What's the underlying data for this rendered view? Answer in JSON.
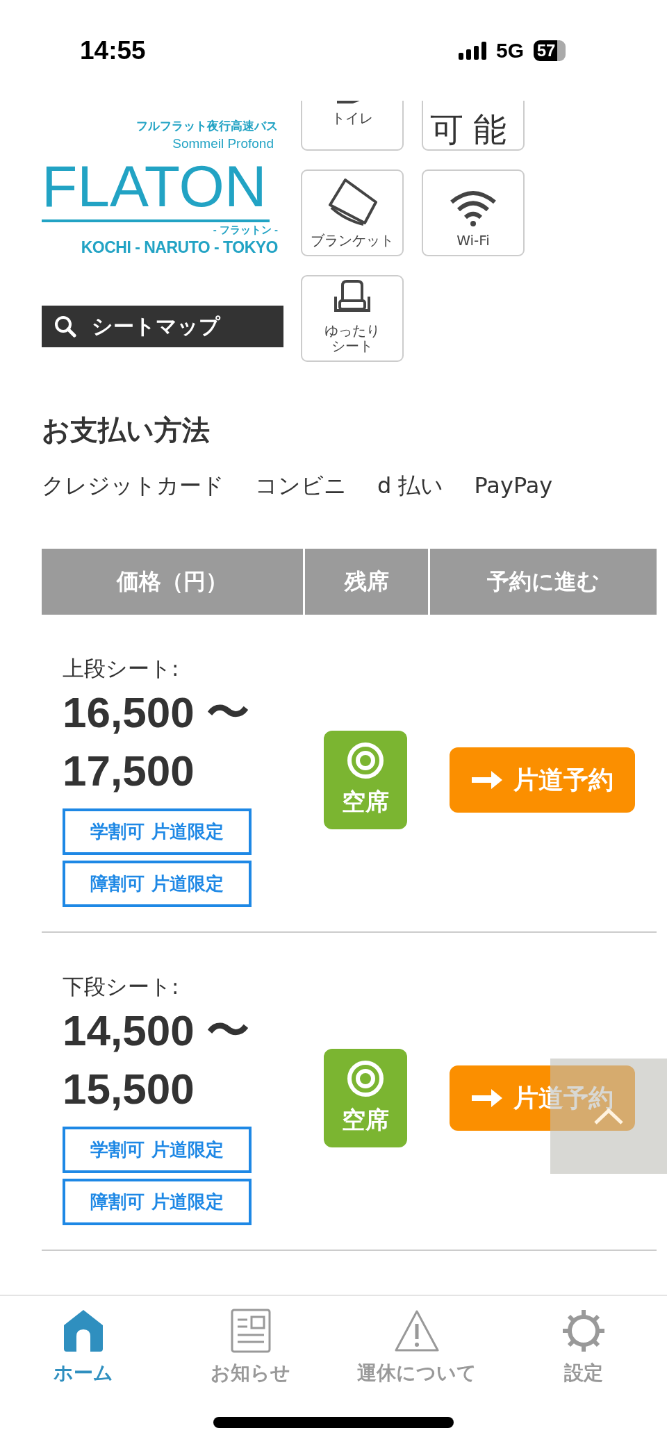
{
  "status_bar": {
    "time": "14:55",
    "network": "5G",
    "battery": "57"
  },
  "logo": {
    "tagline": "フルフラット夜行高速バス",
    "subtitle": "Sommeil Profond",
    "name": "FLATON",
    "reading": "- フラットン -",
    "route": "KOCHI - NARUTO - TOKYO"
  },
  "seat_map_button": "シートマップ",
  "amenities": [
    {
      "kind": "toilet",
      "label": "トイレ"
    },
    {
      "kind": "text",
      "label": "可能"
    },
    {
      "kind": "blanket",
      "label": "ブランケット"
    },
    {
      "kind": "wifi",
      "label": "Wi-Fi"
    },
    {
      "kind": "seat",
      "label": "ゆったりシート"
    }
  ],
  "payment": {
    "title": "お支払い方法",
    "methods": [
      "クレジットカード",
      "コンビニ",
      "d 払い",
      "PayPay"
    ]
  },
  "table": {
    "columns": [
      "価格（円）",
      "残席",
      "予約に進む"
    ],
    "rows": [
      {
        "seat": "上段シート:",
        "price": [
          "16,500 〜",
          "17,500"
        ],
        "discounts": [
          "学割可 片道限定",
          "障割可 片道限定"
        ],
        "availability": {
          "kind": "vacant",
          "label": "空席"
        },
        "button": "片道予約"
      },
      {
        "seat": "下段シート:",
        "price": [
          "14,500 〜",
          "15,500"
        ],
        "discounts": [
          "学割可 片道限定",
          "障割可 片道限定"
        ],
        "availability": {
          "kind": "vacant",
          "label": "空席"
        },
        "button": "片道予約"
      }
    ]
  },
  "tab_bar": [
    {
      "kind": "home",
      "label": "ホーム",
      "selected": true
    },
    {
      "kind": "news",
      "label": "お知らせ",
      "selected": false
    },
    {
      "kind": "warning",
      "label": "運休について",
      "selected": false
    },
    {
      "kind": "settings",
      "label": "設定",
      "selected": false
    }
  ]
}
